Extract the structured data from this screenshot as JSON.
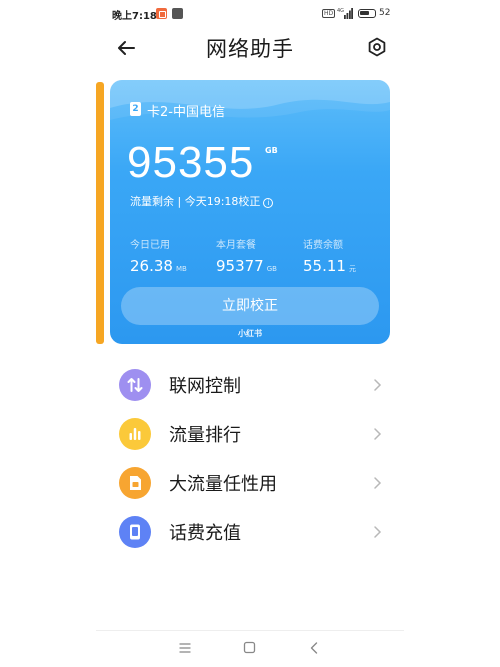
{
  "status_bar": {
    "time": "晚上7:18",
    "battery": "52",
    "hd_label": "HD"
  },
  "header": {
    "title": "网络助手"
  },
  "card": {
    "sim_number": "2",
    "sim_label": "卡2-中国电信",
    "remaining_value": "95355",
    "remaining_unit": "GB",
    "remaining_caption": "流量剩余 | 今天19:18校正",
    "stats": [
      {
        "label": "今日已用",
        "value": "26.38",
        "unit": "MB"
      },
      {
        "label": "本月套餐",
        "value": "95377",
        "unit": "GB"
      },
      {
        "label": "话费余额",
        "value": "55.11",
        "unit": "元"
      }
    ],
    "calibrate_label": "立即校正",
    "watermark": "小红书",
    "colors": {
      "card_top": "#5dbdfa",
      "card_bottom": "#2c98f0",
      "side_accent": "#f6a623"
    }
  },
  "menu": {
    "items": [
      {
        "label": "联网控制",
        "icon": "network-arrows-icon",
        "color": "#9e8ff0"
      },
      {
        "label": "流量排行",
        "icon": "bar-chart-icon",
        "color": "#fbc93a"
      },
      {
        "label": "大流量任性用",
        "icon": "sim-card-icon",
        "color": "#f7a531"
      },
      {
        "label": "话费充值",
        "icon": "phone-card-icon",
        "color": "#5e82f5"
      }
    ]
  }
}
